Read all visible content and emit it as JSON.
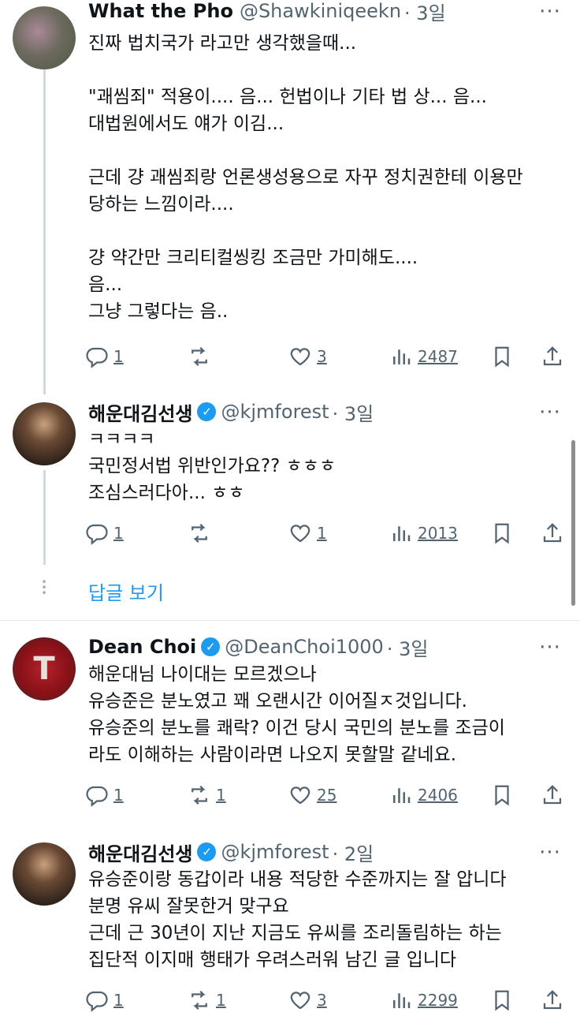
{
  "tweets": [
    {
      "name": "What the Pho",
      "handle": "@Shawkiniqeekn",
      "time": "· 3일",
      "more": "···",
      "text": "진짜 법치국가 라고만 생각했을때...\n\n\"괘씸죄\" 적용이.... 음... 헌법이나 기타 법 상... 음...\n대법원에서도 얘가 이김...\n\n근데 걍 괘씸죄랑 언론생성용으로 자꾸 정치권한테 이용만\n당하는 느낌이라....\n\n걍 약간만 크리티컬씽킹 조금만 가미해도....\n음...\n그냥 그렇다는 음..",
      "reply": "1",
      "retweet": "",
      "like": "3",
      "views": "2487"
    },
    {
      "name": "해운대김선생",
      "handle": "@kjmforest",
      "time": "· 3일",
      "more": "···",
      "text": "ㅋㅋㅋㅋ\n국민정서법 위반인가요?? ㅎㅎㅎ\n조심스러다아... ㅎㅎ",
      "reply": "1",
      "retweet": "",
      "like": "1",
      "views": "2013"
    },
    {
      "name": "Dean Choi",
      "handle": "@DeanChoi1000",
      "time": "· 3일",
      "more": "···",
      "text": "해운대님 나이대는 모르겠으나\n유승준은 분노였고 꽤 오랜시간 이어질ㅈ것입니다.\n유승준의 분노를 쾌락?  이건 당시 국민의 분노를 조금이\n라도 이해하는 사람이라면 나오지 못할말 같네요.",
      "reply": "1",
      "retweet": "1",
      "like": "25",
      "views": "2406"
    },
    {
      "name": "해운대김선생",
      "handle": "@kjmforest",
      "time": "· 2일",
      "more": "···",
      "text": "유승준이랑 동갑이라 내용 적당한 수준까지는 잘 압니다\n분명 유씨 잘못한거 맞구요\n근데 근 30년이 지난 지금도 유씨를 조리돌림하는 하는\n집단적 이지매 행태가 우려스러워 남긴 글 입니다",
      "reply": "1",
      "retweet": "1",
      "like": "3",
      "views": "2299"
    }
  ],
  "show_replies": "답글 보기",
  "icons": [
    "reply-icon",
    "retweet-icon",
    "like-icon",
    "views-icon",
    "bookmark-icon",
    "share-icon",
    "verified-icon"
  ],
  "colors": {
    "accent": "#1d9bf0",
    "muted": "#536471",
    "text": "#0f1419"
  }
}
